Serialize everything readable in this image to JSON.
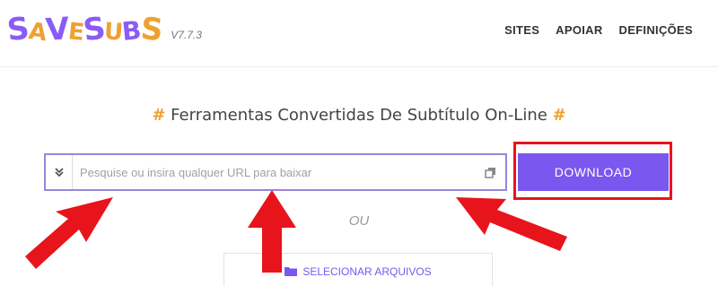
{
  "header": {
    "logo_letters": [
      "S",
      "A",
      "V",
      "E",
      "S",
      "U",
      "B",
      "S"
    ],
    "logo_colors": [
      "#8a5cf5",
      "#f0a030",
      "#8a5cf5",
      "#f0a030",
      "#8a5cf5",
      "#f0a030",
      "#8a5cf5",
      "#f0a030"
    ],
    "version": "V7.7.3",
    "nav": [
      "SITES",
      "APOIAR",
      "DEFINIÇÕES"
    ]
  },
  "main": {
    "hash_symbol": "#",
    "headline": "Ferramentas Convertidas De Subtítulo On-Line",
    "search": {
      "placeholder": "Pesquise ou insira qualquer URL para baixar",
      "value": ""
    },
    "download_label": "DOWNLOAD",
    "or_label": "OU",
    "select_files_label": "SELECIONAR ARQUIVOS"
  },
  "colors": {
    "accent": "#7a57ee",
    "highlight_red": "#e8141c",
    "hash_orange": "#f0a030"
  },
  "icons": {
    "expand": "chevrons-down-icon",
    "paste": "paste-icon",
    "folder": "folder-icon"
  }
}
